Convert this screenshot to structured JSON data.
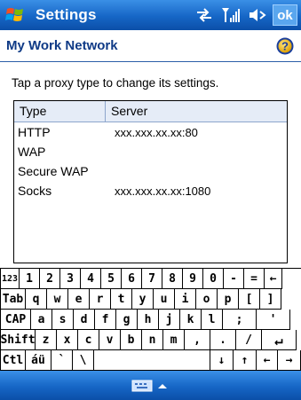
{
  "titlebar": {
    "app_title": "Settings",
    "ok_label": "ok",
    "icons": [
      "windows-flag-icon",
      "connectivity-icon",
      "signal-icon",
      "volume-icon"
    ]
  },
  "header": {
    "title": "My Work Network",
    "help_icon": "help-icon"
  },
  "instruction": "Tap a proxy type to change its settings.",
  "list": {
    "columns": [
      "Type",
      "Server"
    ],
    "rows": [
      {
        "type": "HTTP",
        "server": "xxx.xxx.xx.xx:80"
      },
      {
        "type": "WAP",
        "server": ""
      },
      {
        "type": "Secure WAP",
        "server": ""
      },
      {
        "type": "Socks",
        "server": "xxx.xxx.xx.xx:1080"
      }
    ]
  },
  "keyboard": {
    "row1": [
      "123",
      "1",
      "2",
      "3",
      "4",
      "5",
      "6",
      "7",
      "8",
      "9",
      "0",
      "-",
      "=",
      "←"
    ],
    "row2": [
      "Tab",
      "q",
      "w",
      "e",
      "r",
      "t",
      "y",
      "u",
      "i",
      "o",
      "p",
      "[",
      "]"
    ],
    "row3": [
      "CAP",
      "a",
      "s",
      "d",
      "f",
      "g",
      "h",
      "j",
      "k",
      "l",
      ";",
      "'"
    ],
    "row4": [
      "Shift",
      "z",
      "x",
      "c",
      "v",
      "b",
      "n",
      "m",
      ",",
      ".",
      "/",
      "↵"
    ],
    "row5": [
      "Ctl",
      "áü",
      "`",
      "\\",
      "",
      "↓",
      "↑",
      "←",
      "→"
    ]
  },
  "menubar": {
    "sip_icon": "keyboard-icon"
  },
  "colors": {
    "titlebar_blue": "#1666c6",
    "heading_text": "#0f3a86"
  }
}
